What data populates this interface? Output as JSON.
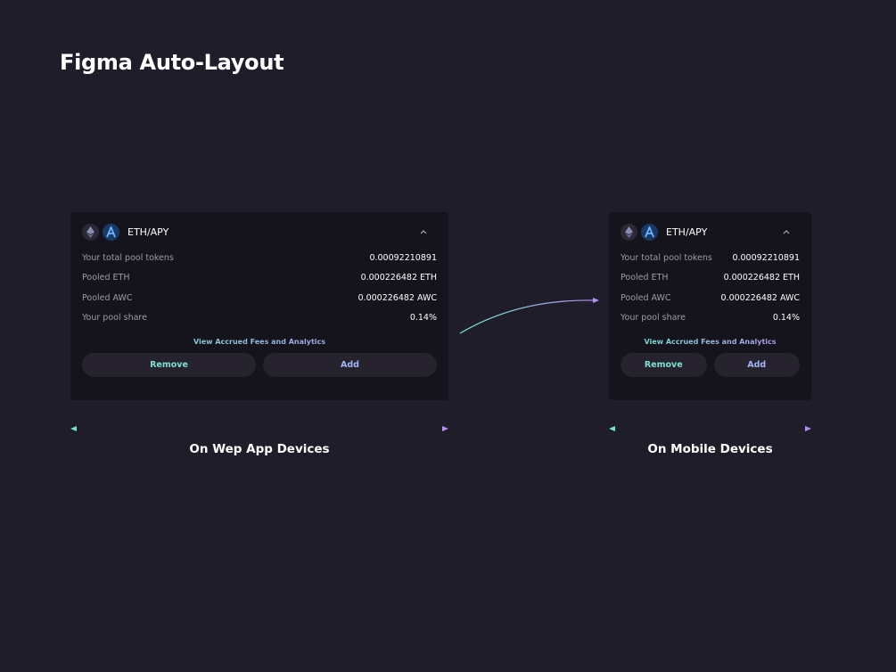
{
  "title": "Figma Auto-Layout",
  "colors": {
    "background": "#201d2b",
    "card": "#15131b",
    "accent_teal": "#6ee7c9",
    "accent_purple": "#b690f5"
  },
  "web_card": {
    "pair": "ETH/APY",
    "icons": [
      "ethereum-icon",
      "a-token-icon",
      "chevron-up-icon"
    ],
    "rows": [
      {
        "label": "Your total pool tokens",
        "value": "0.00092210891"
      },
      {
        "label": "Pooled ETH",
        "value": "0.000226482 ETH"
      },
      {
        "label": "Pooled AWC",
        "value": "0.000226482 AWC"
      },
      {
        "label": "Your pool share",
        "value": "0.14%"
      }
    ],
    "link": "View Accrued Fees and Analytics",
    "remove_label": "Remove",
    "add_label": "Add"
  },
  "mobile_card": {
    "pair": "ETH/APY",
    "rows": [
      {
        "label": "Your total pool tokens",
        "value": "0.00092210891"
      },
      {
        "label": "Pooled ETH",
        "value": "0.000226482 ETH"
      },
      {
        "label": "Pooled AWC",
        "value": "0.000226482 AWC"
      },
      {
        "label": "Your pool share",
        "value": "0.14%"
      }
    ],
    "link": "View Accrued Fees and Analytics",
    "remove_label": "Remove",
    "add_label": "Add"
  },
  "captions": {
    "web": "On Wep App Devices",
    "mobile": "On Mobile Devices"
  }
}
